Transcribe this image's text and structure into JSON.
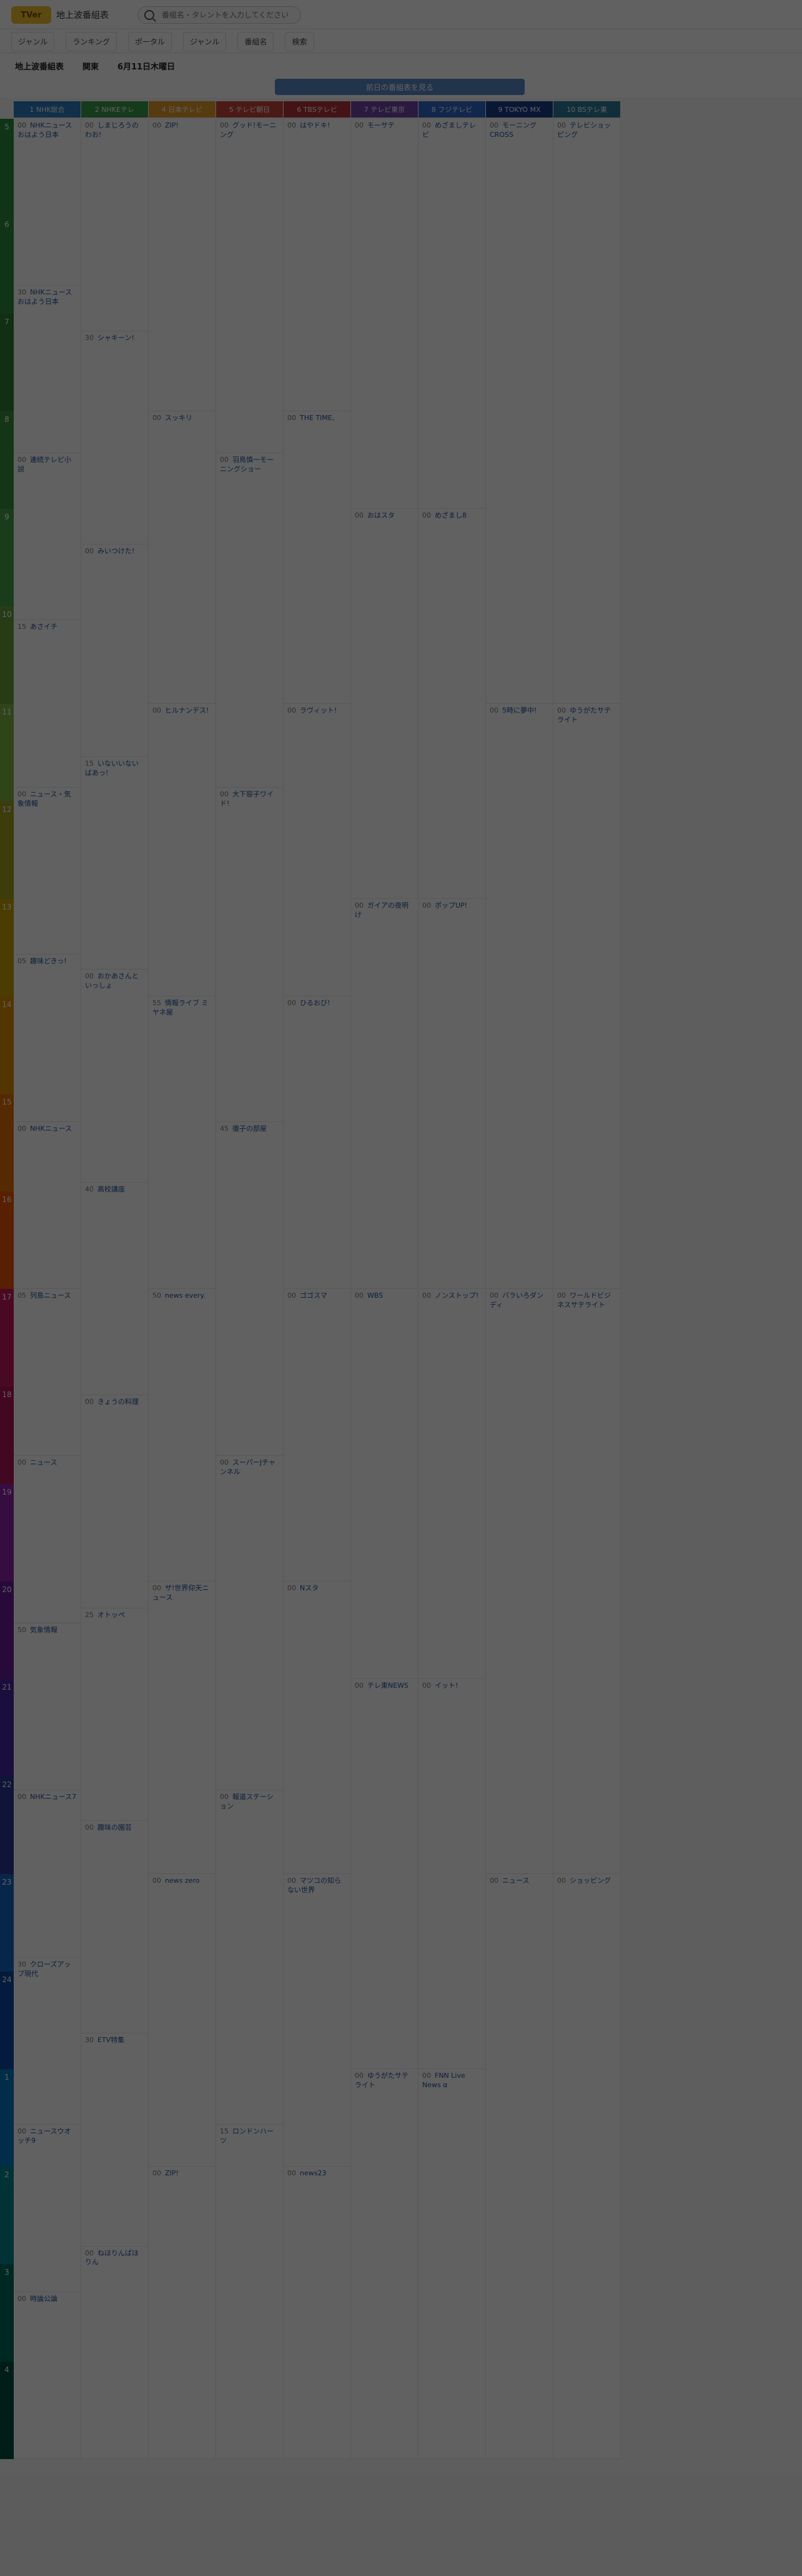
{
  "app": {
    "logo": "TVer",
    "title": "地上波番組表",
    "search_placeholder": "番組名・タレントを入力してください"
  },
  "filters": [
    "ジャンル",
    "ランキング",
    "ポータル",
    "ジャンル",
    "番組名",
    "検索"
  ],
  "date": {
    "area": "地上波番組表",
    "region": "関東",
    "day": "6月11日木曜日"
  },
  "more_button": "前日の番組表を見る",
  "channels": [
    {
      "name": "1 NHK総合",
      "color": "#2e7bbf"
    },
    {
      "name": "2 NHKEテレ",
      "color": "#3c9a4a"
    },
    {
      "name": "4 日本テレビ",
      "color": "#e39b2e"
    },
    {
      "name": "5 テレビ朝日",
      "color": "#c8443b"
    },
    {
      "name": "6 TBSテレビ",
      "color": "#b4323b"
    },
    {
      "name": "7 テレビ東京",
      "color": "#6e46a8"
    },
    {
      "name": "8 フジテレビ",
      "color": "#3068c8"
    },
    {
      "name": "9 TOKYO MX",
      "color": "#1c3e88"
    },
    {
      "name": "10 BSテレ東",
      "color": "#2a7b9a"
    }
  ],
  "hours": [
    "5",
    "6",
    "7",
    "8",
    "9",
    "10",
    "11",
    "12",
    "13",
    "14",
    "15",
    "16",
    "17",
    "18",
    "19",
    "20",
    "21",
    "22",
    "23",
    "24",
    "1",
    "2",
    "3",
    "4"
  ],
  "programs": [
    [
      [
        "00",
        "NHKニュース おはよう日本"
      ],
      [
        "30",
        "NHKニュース おはよう日本"
      ],
      [
        "00",
        "連続テレビ小説"
      ],
      [
        "15",
        "あさイチ"
      ],
      [
        "00",
        "ニュース・気象情報"
      ],
      [
        "05",
        "趣味どきっ!"
      ],
      [
        "00",
        "NHKニュース"
      ],
      [
        "05",
        "列島ニュース"
      ],
      [
        "00",
        "ニュース"
      ],
      [
        "50",
        "気象情報"
      ],
      [
        "00",
        "NHKニュース7"
      ],
      [
        "30",
        "クローズアップ現代"
      ],
      [
        "00",
        "ニュースウオッチ9"
      ],
      [
        "00",
        "時論公論"
      ]
    ],
    [
      [
        "00",
        "しまじろうのわお!"
      ],
      [
        "30",
        "シャキーン!"
      ],
      [
        "00",
        "みいつけた!"
      ],
      [
        "15",
        "いないいないばあっ!"
      ],
      [
        "00",
        "おかあさんといっしょ"
      ],
      [
        "40",
        "高校講座"
      ],
      [
        "00",
        "きょうの料理"
      ],
      [
        "25",
        "オトッペ"
      ],
      [
        "00",
        "趣味の園芸"
      ],
      [
        "30",
        "ETV特集"
      ],
      [
        "00",
        "ねほりんぱほりん"
      ]
    ],
    [
      [
        "00",
        "ZIP!"
      ],
      [
        "00",
        "スッキリ"
      ],
      [
        "00",
        "ヒルナンデス!"
      ],
      [
        "55",
        "情報ライブ ミヤネ屋"
      ],
      [
        "50",
        "news every."
      ],
      [
        "00",
        "ザ!世界仰天ニュース"
      ],
      [
        "00",
        "news zero"
      ],
      [
        "00",
        "ZIP!"
      ]
    ],
    [
      [
        "00",
        "グッド!モーニング"
      ],
      [
        "00",
        "羽鳥慎一モーニングショー"
      ],
      [
        "00",
        "大下容子ワイド!"
      ],
      [
        "45",
        "徹子の部屋"
      ],
      [
        "00",
        "スーパーJチャンネル"
      ],
      [
        "00",
        "報道ステーション"
      ],
      [
        "15",
        "ロンドンハーツ"
      ]
    ],
    [
      [
        "00",
        "はやドキ!"
      ],
      [
        "00",
        "THE TIME,"
      ],
      [
        "00",
        "ラヴィット!"
      ],
      [
        "00",
        "ひるおび!"
      ],
      [
        "00",
        "ゴゴスマ"
      ],
      [
        "00",
        "Nスタ"
      ],
      [
        "00",
        "マツコの知らない世界"
      ],
      [
        "00",
        "news23"
      ]
    ],
    [
      [
        "00",
        "モーサテ"
      ],
      [
        "00",
        "おはスタ"
      ],
      [
        "00",
        "ガイアの夜明け"
      ],
      [
        "00",
        "WBS"
      ],
      [
        "00",
        "テレ東NEWS"
      ],
      [
        "00",
        "ゆうがたサテライト"
      ]
    ],
    [
      [
        "00",
        "めざましテレビ"
      ],
      [
        "00",
        "めざまし8"
      ],
      [
        "00",
        "ポップUP!"
      ],
      [
        "00",
        "ノンストップ!"
      ],
      [
        "00",
        "イット!"
      ],
      [
        "00",
        "FNN Live News α"
      ]
    ],
    [
      [
        "00",
        "モーニングCROSS"
      ],
      [
        "00",
        "5時に夢中!"
      ],
      [
        "00",
        "バラいろダンディ"
      ],
      [
        "00",
        "ニュース"
      ]
    ],
    [
      [
        "00",
        "テレビショッピング"
      ],
      [
        "00",
        "ゆうがたサテライト"
      ],
      [
        "00",
        "ワールドビジネスサテライト"
      ],
      [
        "00",
        "ショッピング"
      ]
    ]
  ]
}
